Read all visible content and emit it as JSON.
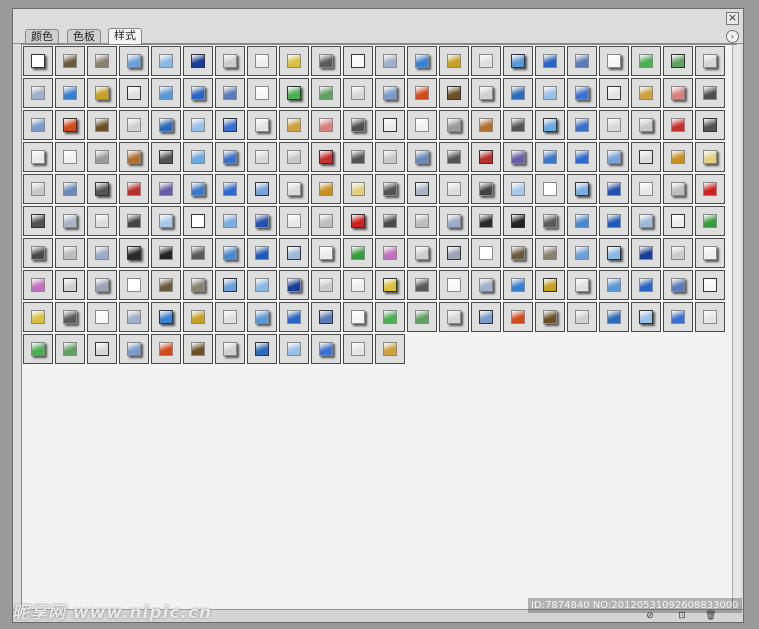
{
  "tabs": [
    {
      "label": "颜色",
      "active": false
    },
    {
      "label": "色板",
      "active": false
    },
    {
      "label": "样式",
      "active": true
    }
  ],
  "panel": {
    "close_glyph": "×",
    "menu_glyph": "›",
    "swatch_count": 210
  },
  "bottom_icons": [
    "clear-style-icon",
    "new-style-icon",
    "delete-style-icon"
  ],
  "bottom_glyphs": [
    "⊘",
    "⊡",
    "🗑"
  ],
  "watermark": {
    "brand": "昵享网 www.nipic.cn",
    "id": "ID:7874840 NO:20120531092608833000"
  },
  "colors": {
    "panel_bg": "#dcdcdc",
    "grid_bg": "#f2f2f2",
    "accent_blue": "#2f6bd0"
  }
}
